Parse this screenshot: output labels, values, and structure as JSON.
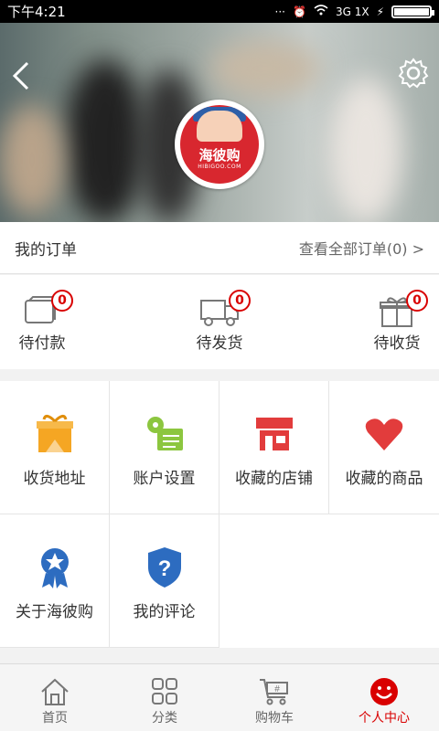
{
  "status_bar": {
    "time": "下午4:21",
    "network": "3G 1X"
  },
  "hero": {
    "logo_text": "海彼购",
    "logo_sub": "HIBIGOO.COM"
  },
  "orders": {
    "title": "我的订单",
    "view_all": "查看全部订单(0) >",
    "statuses": [
      {
        "label": "待付款",
        "count": "0",
        "icon": "wallet-icon"
      },
      {
        "label": "待发货",
        "count": "0",
        "icon": "truck-icon"
      },
      {
        "label": "待收货",
        "count": "0",
        "icon": "gift-box-icon"
      }
    ]
  },
  "grid": [
    {
      "label": "收货地址",
      "icon": "address-box-icon"
    },
    {
      "label": "账户设置",
      "icon": "account-settings-icon"
    },
    {
      "label": "收藏的店铺",
      "icon": "store-icon"
    },
    {
      "label": "收藏的商品",
      "icon": "heart-icon"
    },
    {
      "label": "关于海彼购",
      "icon": "award-ribbon-icon"
    },
    {
      "label": "我的评论",
      "icon": "question-shield-icon"
    }
  ],
  "tabbar": [
    {
      "label": "首页",
      "icon": "home-icon"
    },
    {
      "label": "分类",
      "icon": "category-grid-icon"
    },
    {
      "label": "购物车",
      "icon": "cart-icon"
    },
    {
      "label": "个人中心",
      "icon": "smiley-user-icon",
      "active": true
    }
  ],
  "colors": {
    "accent": "#d90000",
    "orange": "#f5a623",
    "green": "#8cc63f",
    "red": "#e23c3c",
    "blue": "#2d6cc0"
  }
}
